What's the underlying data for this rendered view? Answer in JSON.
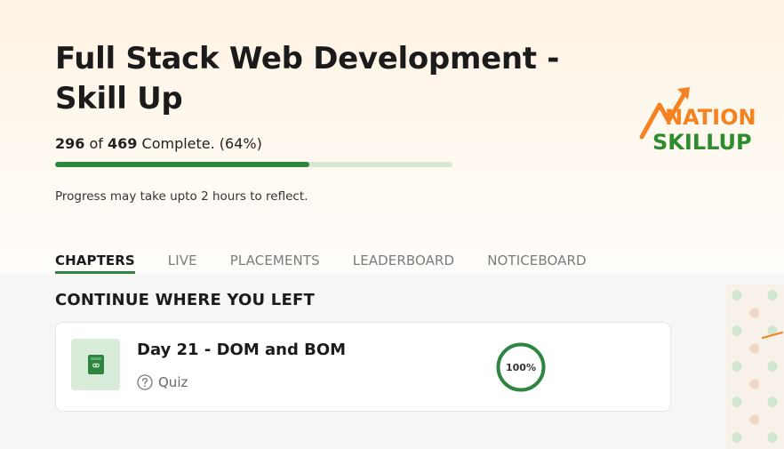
{
  "course": {
    "title": "Full Stack Web Development - Skill Up"
  },
  "progress": {
    "done": "296",
    "of_word": "of",
    "total": "469",
    "suffix": "Complete. (64%)",
    "percent": 64,
    "note": "Progress may take upto 2 hours to reflect."
  },
  "logo": {
    "line1": "NATION",
    "line2": "SKILLUP",
    "colors": {
      "orange": "#f58220",
      "green": "#2e8b2e"
    }
  },
  "tabs": [
    {
      "label": "CHAPTERS",
      "active": true
    },
    {
      "label": "LIVE",
      "active": false
    },
    {
      "label": "PLACEMENTS",
      "active": false
    },
    {
      "label": "LEADERBOARD",
      "active": false
    },
    {
      "label": "NOTICEBOARD",
      "active": false
    }
  ],
  "continue": {
    "section_title": "CONTINUE WHERE YOU LEFT",
    "card": {
      "title": "Day 21 - DOM and BOM",
      "type": "Quiz",
      "type_icon": "question-circle-icon",
      "thumb_icon": "book-icon",
      "completion": "100%",
      "completion_value": 100
    }
  },
  "colors": {
    "accent": "#2e8540",
    "track": "#d6e8d4"
  }
}
